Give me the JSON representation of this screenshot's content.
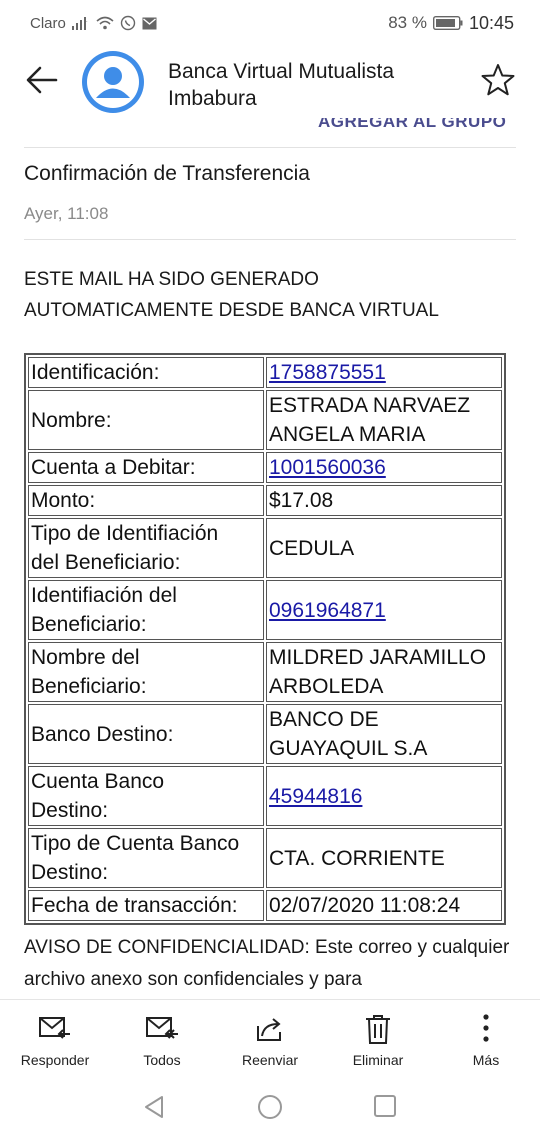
{
  "status_bar": {
    "carrier": "Claro",
    "battery": "83 %",
    "time": "10:45"
  },
  "header": {
    "sender": "Banca Virtual Mutualista Imbabura",
    "add_to_group": "AGREGAR AL GRUPO"
  },
  "email": {
    "subject": "Confirmación de Transferencia",
    "date": "Ayer, 11:08",
    "notice_line1": "ESTE MAIL HA SIDO GENERADO",
    "notice_line2": "AUTOMATICAMENTE DESDE BANCA VIRTUAL",
    "rows": [
      {
        "key": "Identificación:",
        "value": "1758875551",
        "link": true
      },
      {
        "key": "Nombre:",
        "value_line1": "ESTRADA NARVAEZ",
        "value_line2": "ANGELA MARIA"
      },
      {
        "key": "Cuenta a Debitar:",
        "value": "1001560036",
        "link": true
      },
      {
        "key": "Monto:",
        "value": "$17.08"
      },
      {
        "key_line1": "Tipo de Identifiación",
        "key_line2": "del Beneficiario:",
        "value": "CEDULA"
      },
      {
        "key_line1": "Identifiación del",
        "key_line2": "Beneficiario:",
        "value": "0961964871",
        "link": true
      },
      {
        "key_line1": "Nombre del",
        "key_line2": "Beneficiario:",
        "value_line1": "MILDRED JARAMILLO",
        "value_line2": "ARBOLEDA"
      },
      {
        "key": "Banco Destino:",
        "value_line1": "BANCO DE",
        "value_line2": "GUAYAQUIL S.A"
      },
      {
        "key_line1": "Cuenta Banco",
        "key_line2": "Destino:",
        "value": "45944816",
        "link": true
      },
      {
        "key_line1": "Tipo de Cuenta Banco",
        "key_line2": "Destino:",
        "value": "CTA. CORRIENTE"
      },
      {
        "key": "Fecha de transacción:",
        "value": "02/07/2020 11:08:24"
      }
    ],
    "disclaimer": "AVISO DE CONFIDENCIALIDAD: Este correo y cualquier archivo anexo son confidenciales y para"
  },
  "actions": {
    "reply": "Responder",
    "reply_all": "Todos",
    "forward": "Reenviar",
    "delete": "Eliminar",
    "more": "Más"
  },
  "icons": {
    "back": "arrow-left-icon",
    "avatar": "person-icon",
    "star": "star-outline-icon",
    "reply": "mail-reply-icon",
    "reply_all": "mail-reply-all-icon",
    "forward": "forward-icon",
    "delete": "trash-icon",
    "more": "vertical-dots-icon"
  },
  "colors": {
    "avatar_bg": "#3f8de8",
    "link": "#1a1aa6",
    "group_link": "#4a4c8e"
  }
}
